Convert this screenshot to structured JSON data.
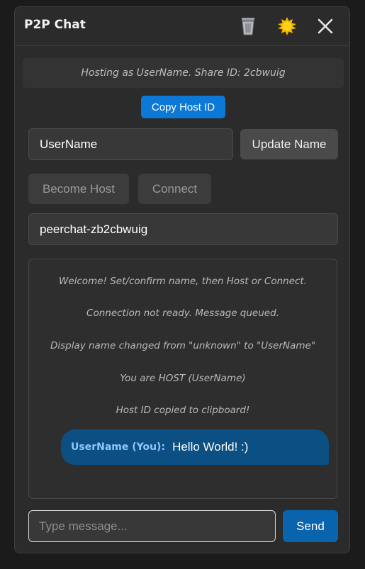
{
  "window": {
    "title": "P2P Chat",
    "icons": {
      "clear": "trash-icon",
      "theme": "sun-icon",
      "close": "close-icon"
    }
  },
  "status": {
    "text": "Hosting as UserName. Share ID: 2cbwuig"
  },
  "controls": {
    "copy_host_id_label": "Copy Host ID",
    "name_value": "UserName",
    "update_name_label": "Update Name",
    "become_host_label": "Become Host",
    "connect_label": "Connect",
    "peer_id_value": "peerchat-zb2cbwuig"
  },
  "chat": {
    "system_messages": [
      "Welcome! Set/confirm name, then Host or Connect.",
      "Connection not ready. Message queued.",
      "Display name changed from \"unknown\" to \"UserName\"",
      "You are HOST (UserName)",
      "Host ID copied to clipboard!"
    ],
    "user_message": {
      "sender": "UserName (You):",
      "text": "Hello World! :)"
    }
  },
  "composer": {
    "placeholder": "Type message...",
    "send_label": "Send"
  },
  "colors": {
    "accent": "#0d79d6",
    "send": "#0a63ad",
    "bubble": "#0c4f82",
    "window_bg": "#2b2b2b"
  }
}
